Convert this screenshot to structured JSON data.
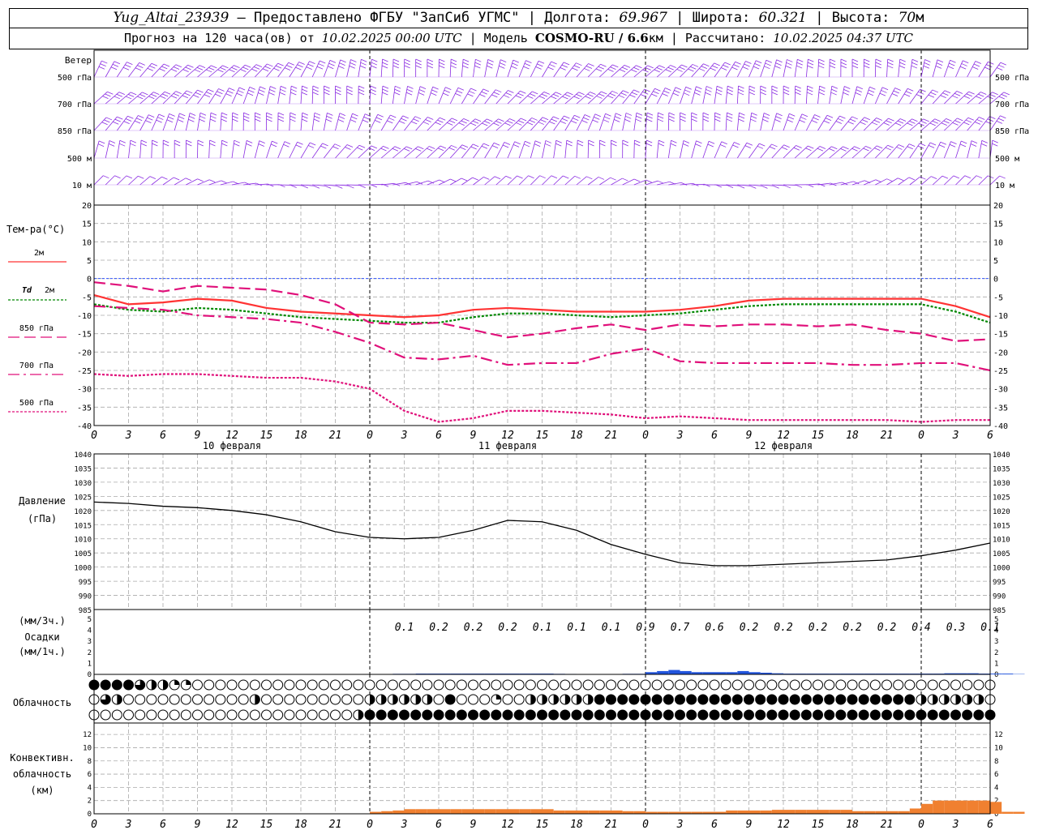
{
  "header": {
    "station": "Yug_Altai_23939",
    "provided": "– Предоставлено ФГБУ \"ЗапСиб УГМС\"",
    "lon_label": "Долгота:",
    "lon": "69.967",
    "lat_label": "Широта:",
    "lat": "60.321",
    "alt_label": "Высота:",
    "alt": "70",
    "alt_unit": "м",
    "forecast_label": "Прогноз на 120 часа(ов) от",
    "forecast_time": "10.02.2025 00:00 UTC",
    "model_label": "Модель",
    "model": "COSMO-RU / 6.6",
    "model_unit": "км",
    "calc_label": "Рассчитано:",
    "calc_time": "10.02.2025 04:37 UTC"
  },
  "colors": {
    "wind": "#8a2be2",
    "t2m": "#ff3333",
    "td2m": "#008800",
    "t850": "#e0107a",
    "zero_line": "#3355ff",
    "precip": "#2255dd",
    "convective": "#f08030",
    "pressure": "#000000",
    "grid": "#aaaaaa"
  },
  "labels": {
    "wind_title": "Ветер",
    "wind_levels": [
      "500 гПа",
      "700 гПа",
      "850 гПа",
      "500 м",
      "10 м"
    ],
    "temp_title": "Тем-ра(°С)",
    "leg_2m": "2м",
    "leg_td_a": "Td",
    "leg_td_b": "2м",
    "leg_850": "850 гПа",
    "leg_700": "700 гПа",
    "leg_500": "500 гПа",
    "days": [
      "10 февраля",
      "11 февраля",
      "12 февраля"
    ],
    "pressure_a": "Давление",
    "pressure_b": "(гПа)",
    "precip_a": "(мм/3ч.)",
    "precip_b": "Осадки",
    "precip_c": "(мм/1ч.)",
    "cloud": "Облачность",
    "conv_a": "Конвективн.",
    "conv_b": "облачность",
    "conv_c": "(км)"
  },
  "chart_data": {
    "type": "line",
    "x_hours": [
      0,
      3,
      6,
      9,
      12,
      15,
      18,
      21,
      24,
      27,
      30,
      33,
      36,
      39,
      42,
      45,
      48,
      51,
      54,
      57,
      60,
      63,
      66,
      69,
      72,
      75,
      78
    ],
    "x_tick_labels": [
      "0",
      "3",
      "6",
      "9",
      "12",
      "15",
      "18",
      "21",
      "0",
      "3",
      "6",
      "9",
      "12",
      "15",
      "18",
      "21",
      "0",
      "3",
      "6",
      "9",
      "12",
      "15",
      "18",
      "21",
      "0",
      "3",
      "6"
    ],
    "temperature": {
      "ylim": [
        -40,
        20
      ],
      "yticks": [
        "20",
        "15",
        "10",
        "5",
        "0",
        "-5",
        "-10",
        "-15",
        "-20",
        "-25",
        "-30",
        "-35",
        "-40"
      ],
      "series": [
        {
          "name": "2м",
          "values": [
            -4.5,
            -7,
            -6.5,
            -5.5,
            -6,
            -8,
            -9,
            -9.5,
            -10,
            -10.5,
            -10,
            -8.5,
            -8,
            -8.5,
            -9,
            -9,
            -9,
            -8.5,
            -7.5,
            -6,
            -5.5,
            -5.5,
            -5.5,
            -5.5,
            -5.5,
            -7.5,
            -10.5
          ]
        },
        {
          "name": "Td 2м",
          "values": [
            -7,
            -8.5,
            -9,
            -8,
            -8.5,
            -9.5,
            -10.5,
            -11,
            -11.5,
            -12,
            -12,
            -10.5,
            -9.5,
            -9.5,
            -10,
            -10.5,
            -10,
            -9.5,
            -8.5,
            -7.5,
            -7,
            -7,
            -7,
            -7,
            -7,
            -9,
            -12
          ]
        },
        {
          "name": "850 гПа",
          "values": [
            -1,
            -2,
            -3.5,
            -2,
            -2.5,
            -3,
            -4.5,
            -7,
            -12,
            -12.5,
            -12,
            -14,
            -16,
            -15,
            -13.5,
            -12.5,
            -14,
            -12.5,
            -13,
            -12.5,
            -12.5,
            -13,
            -12.5,
            -14,
            -15,
            -17,
            -16.5
          ]
        },
        {
          "name": "700 гПа",
          "values": [
            -7.5,
            -8,
            -8.5,
            -10,
            -10.5,
            -11,
            -12,
            -14.5,
            -17.5,
            -21.5,
            -22,
            -21,
            -23.5,
            -23,
            -23,
            -20.5,
            -19,
            -22.5,
            -23,
            -23,
            -23,
            -23,
            -23.5,
            -23.5,
            -23,
            -23,
            -25
          ]
        },
        {
          "name": "500 гПа",
          "values": [
            -26,
            -26.5,
            -26,
            -26,
            -26.5,
            -27,
            -27,
            -28,
            -30,
            -36,
            -39,
            -38,
            -36,
            -36,
            -36.5,
            -37,
            -38,
            -37.5,
            -38,
            -38.5,
            -38.5,
            -38.5,
            -38.5,
            -38.5,
            -39,
            -38.5,
            -38.5
          ]
        }
      ]
    },
    "pressure": {
      "ylim": [
        985,
        1040
      ],
      "yticks": [
        "1040",
        "1035",
        "1030",
        "1025",
        "1020",
        "1015",
        "1010",
        "1005",
        "1000",
        "995",
        "990",
        "985"
      ],
      "values": [
        1023,
        1022.5,
        1021.5,
        1021,
        1020,
        1018.5,
        1016,
        1012.5,
        1010.5,
        1010,
        1010.5,
        1013,
        1016.5,
        1016,
        1013,
        1008,
        1004.5,
        1001.5,
        1000.5,
        1000.5,
        1001,
        1001.5,
        1002,
        1002.5,
        1004,
        1006,
        1008.5
      ]
    },
    "precip": {
      "ylim": [
        0,
        5
      ],
      "yticks": [
        "5",
        "4",
        "3",
        "2",
        "1",
        "0"
      ],
      "totals_3h": [
        "0.1",
        "0.2",
        "0.2",
        "0.2",
        "0.1",
        "0.1",
        "0.1",
        "0.9",
        "0.7",
        "0.6",
        "0.2",
        "0.2",
        "0.2",
        "0.2",
        "0.2",
        "0.4",
        "0.3",
        "0.1"
      ],
      "hourly": [
        0,
        0,
        0,
        0,
        0,
        0,
        0,
        0,
        0,
        0,
        0,
        0,
        0,
        0,
        0,
        0,
        0,
        0,
        0,
        0,
        0,
        0,
        0,
        0,
        0.02,
        0.03,
        0.05,
        0.05,
        0.07,
        0.07,
        0.07,
        0.07,
        0.07,
        0.07,
        0.07,
        0.07,
        0.07,
        0.07,
        0.07,
        0.07,
        0.05,
        0.04,
        0.03,
        0.03,
        0.03,
        0.03,
        0.05,
        0.05,
        0.2,
        0.3,
        0.4,
        0.3,
        0.2,
        0.2,
        0.2,
        0.2,
        0.3,
        0.2,
        0.15,
        0.1,
        0.07,
        0.07,
        0.07,
        0.07,
        0.07,
        0.07,
        0.07,
        0.07,
        0.07,
        0.07,
        0.07,
        0.07,
        0.07,
        0.07,
        0.1,
        0.1,
        0.1,
        0.07,
        0.07,
        0.07,
        0.03
      ]
    },
    "cloud": {
      "legend_note": "",
      "rows": [
        [
          4,
          4,
          4,
          4,
          3,
          2,
          2,
          1,
          1,
          0,
          0,
          0,
          0,
          0,
          0,
          0,
          0,
          0,
          0,
          0,
          0,
          0,
          0,
          0,
          0,
          0,
          0,
          0,
          0,
          0,
          0,
          0,
          0,
          0,
          0,
          0,
          0,
          0,
          0,
          0,
          0,
          0,
          0,
          0,
          0,
          0,
          0,
          0,
          0,
          0,
          0,
          0,
          0,
          0,
          0,
          0,
          0,
          0,
          0,
          0,
          0,
          0,
          0,
          0,
          0,
          0,
          0,
          0,
          0,
          0,
          0,
          0,
          0,
          0,
          0,
          0,
          0,
          0,
          0
        ],
        [
          0,
          3,
          2,
          0,
          0,
          0,
          0,
          0,
          0,
          0,
          0,
          0,
          0,
          0,
          2,
          0,
          0,
          0,
          0,
          0,
          0,
          0,
          0,
          0,
          2,
          2,
          2,
          2,
          2,
          2,
          0,
          4,
          0,
          0,
          0,
          1,
          0,
          0,
          2,
          2,
          2,
          2,
          2,
          2,
          4,
          4,
          4,
          4,
          4,
          4,
          4,
          4,
          4,
          4,
          4,
          4,
          4,
          4,
          4,
          4,
          4,
          4,
          4,
          4,
          4,
          4,
          4,
          4,
          4,
          4,
          4,
          4,
          2,
          2,
          2,
          2,
          2,
          2,
          0
        ],
        [
          0,
          0,
          0,
          0,
          0,
          0,
          0,
          0,
          0,
          0,
          0,
          0,
          0,
          0,
          0,
          0,
          0,
          0,
          0,
          0,
          0,
          0,
          0,
          2,
          4,
          4,
          4,
          4,
          4,
          4,
          4,
          4,
          4,
          4,
          4,
          4,
          4,
          4,
          4,
          4,
          4,
          4,
          4,
          4,
          4,
          4,
          4,
          4,
          4,
          4,
          4,
          4,
          4,
          4,
          4,
          4,
          4,
          4,
          4,
          4,
          4,
          4,
          4,
          4,
          4,
          4,
          4,
          4,
          4,
          4,
          4,
          4,
          4,
          4,
          4,
          4,
          4,
          4,
          4
        ]
      ]
    },
    "convective": {
      "ylim": [
        0,
        13
      ],
      "yticks": [
        "12",
        "10",
        "8",
        "6",
        "4",
        "2",
        "0"
      ],
      "hourly": [
        0,
        0,
        0,
        0,
        0,
        0,
        0,
        0,
        0,
        0,
        0,
        0,
        0,
        0,
        0,
        0,
        0,
        0,
        0,
        0,
        0,
        0,
        0,
        0,
        0.3,
        0.4,
        0.5,
        0.7,
        0.7,
        0.7,
        0.7,
        0.7,
        0.7,
        0.7,
        0.7,
        0.7,
        0.7,
        0.7,
        0.7,
        0.7,
        0.5,
        0.5,
        0.5,
        0.5,
        0.5,
        0.5,
        0.4,
        0.4,
        0.3,
        0.3,
        0.3,
        0.3,
        0.3,
        0.3,
        0.3,
        0.5,
        0.5,
        0.5,
        0.5,
        0.6,
        0.6,
        0.6,
        0.6,
        0.6,
        0.6,
        0.6,
        0.4,
        0.4,
        0.4,
        0.4,
        0.4,
        0.8,
        1.5,
        2,
        2,
        2,
        2,
        2,
        1.8,
        0.3,
        0.3
      ]
    }
  }
}
